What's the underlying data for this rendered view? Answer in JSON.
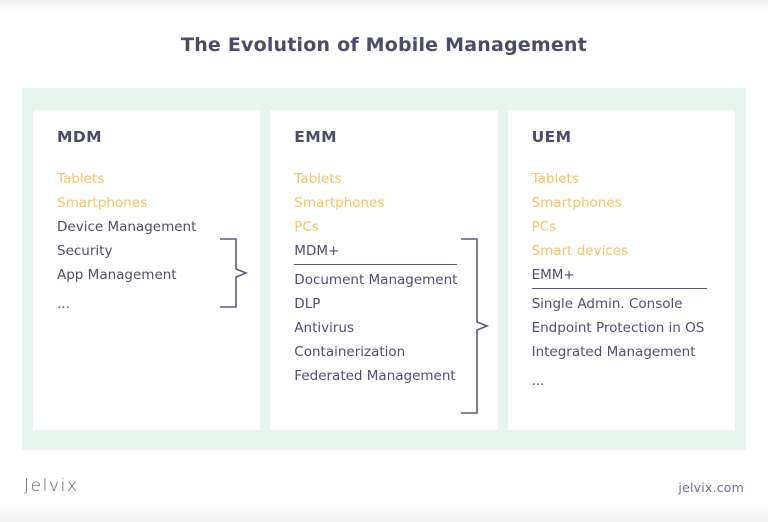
{
  "page": {
    "title": "The Evolution of Mobile Management",
    "background_color": "#ffffff",
    "panel_color": "#e8f3ed",
    "card_color": "#ffffff",
    "accent_color": "#f5c462",
    "text_color": "#4f4f6d",
    "heading_color": "#4b4b6a"
  },
  "columns": [
    {
      "title": "MDM",
      "items": [
        {
          "label": "Tablets",
          "style": "accent"
        },
        {
          "label": "Smartphones",
          "style": "accent"
        },
        {
          "label": "Device Management",
          "style": "normal"
        },
        {
          "label": "Security",
          "style": "normal"
        },
        {
          "label": "App Management",
          "style": "normal"
        },
        {
          "label": "...",
          "style": "normal"
        }
      ]
    },
    {
      "title": "EMM",
      "items": [
        {
          "label": "Tablets",
          "style": "accent"
        },
        {
          "label": "Smartphones",
          "style": "accent"
        },
        {
          "label": "PCs",
          "style": "accent"
        },
        {
          "label": "MDM+",
          "style": "ruled"
        },
        {
          "label": "Document Management",
          "style": "normal"
        },
        {
          "label": "DLP",
          "style": "normal"
        },
        {
          "label": "Antivirus",
          "style": "normal"
        },
        {
          "label": "Containerization",
          "style": "normal"
        },
        {
          "label": "Federated Management",
          "style": "normal"
        }
      ]
    },
    {
      "title": "UEM",
      "items": [
        {
          "label": "Tablets",
          "style": "accent"
        },
        {
          "label": "Smartphones",
          "style": "accent"
        },
        {
          "label": "PCs",
          "style": "accent"
        },
        {
          "label": "Smart devices",
          "style": "accent"
        },
        {
          "label": "EMM+",
          "style": "ruled"
        },
        {
          "label": "Single Admin. Console",
          "style": "normal"
        },
        {
          "label": "Endpoint Protection in OS",
          "style": "normal"
        },
        {
          "label": "Integrated Management",
          "style": "normal"
        },
        {
          "label": "...",
          "style": "normal"
        }
      ]
    }
  ],
  "connectors": [
    {
      "name": "mdm-to-emm",
      "direction": "right"
    },
    {
      "name": "emm-to-uem",
      "direction": "right"
    }
  ],
  "footer": {
    "logo": "Jelvix",
    "website": "jelvix.com"
  }
}
